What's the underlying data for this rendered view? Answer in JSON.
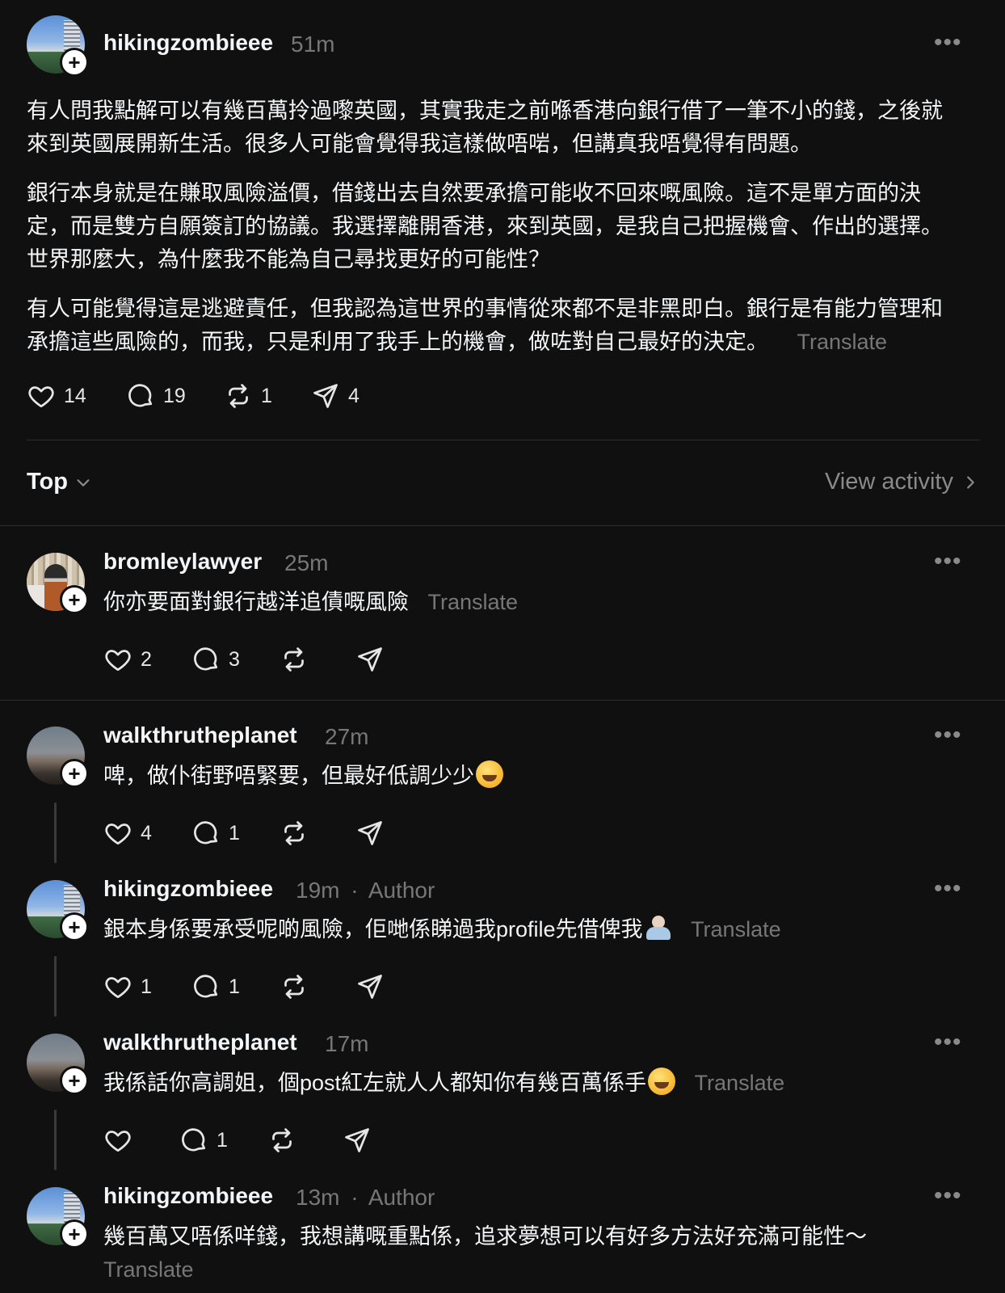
{
  "post": {
    "username": "hikingzombieee",
    "time": "51m",
    "paragraphs": [
      "有人問我點解可以有幾百萬拎過嚟英國，其實我走之前喺香港向銀行借了一筆不小的錢，之後就來到英國展開新生活。很多人可能會覺得我這樣做唔啱，但講真我唔覺得有問題。",
      "銀行本身就是在賺取風險溢價，借錢出去自然要承擔可能收不回來嘅風險。這不是單方面的決定，而是雙方自願簽訂的協議。我選擇離開香港，來到英國，是我自己把握機會、作出的選擇。世界那麼大，為什麼我不能為自己尋找更好的可能性？",
      "有人可能覺得這是逃避責任，但我認為這世界的事情從來都不是非黑即白。銀行是有能力管理和承擔這些風險的，而我，只是利用了我手上的機會，做咗對自己最好的決定。"
    ],
    "translate": "Translate",
    "likes": "14",
    "comments": "19",
    "reposts": "1",
    "shares": "4"
  },
  "sort": {
    "label": "Top",
    "view_activity": "View activity"
  },
  "replies": [
    {
      "username": "bromleylawyer",
      "time": "25m",
      "author": "",
      "text": "你亦要面對銀行越洋追債嘅風險",
      "translate": "Translate",
      "likes": "2",
      "comments": "3"
    },
    {
      "username": "walkthrutheplanet",
      "time": "27m",
      "author": "",
      "text": "啤，做仆街野唔緊要，但最好低調少少",
      "translate": "",
      "likes": "4",
      "comments": "1"
    },
    {
      "username": "hikingzombieee",
      "time": "19m",
      "author": "Author",
      "text": "銀本身係要承受呢啲風險，佢哋係睇過我profile先借俾我",
      "translate": "Translate",
      "likes": "1",
      "comments": "1"
    },
    {
      "username": "walkthrutheplanet",
      "time": "17m",
      "author": "",
      "text": "我係話你高調姐，個post紅左就人人都知你有幾百萬係手",
      "translate": "Translate",
      "likes": "",
      "comments": "1"
    },
    {
      "username": "hikingzombieee",
      "time": "13m",
      "author": "Author",
      "text": "幾百萬又唔係咩錢，我想講嘅重點係，追求夢想可以有好多方法好充滿可能性～",
      "translate": "Translate"
    }
  ],
  "separator": "·",
  "more": "•••",
  "icons": [
    "heart-icon",
    "comment-icon",
    "repost-icon",
    "share-icon",
    "plus-icon",
    "more-icon",
    "chevron-down-icon",
    "chevron-right-icon"
  ]
}
